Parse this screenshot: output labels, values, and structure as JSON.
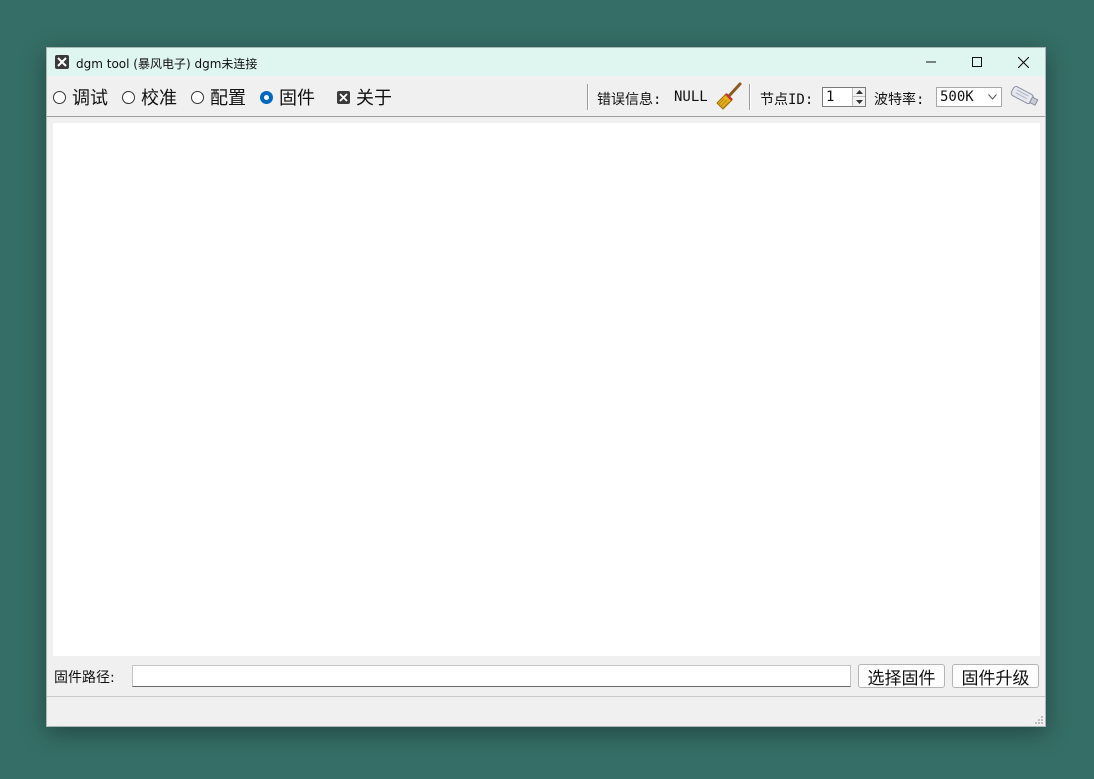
{
  "window": {
    "title": "dgm tool (暴风电子)  dgm未连接",
    "icon": "wrench-icon"
  },
  "toolbar": {
    "tabs": [
      {
        "label": "调试",
        "checked": false
      },
      {
        "label": "校准",
        "checked": false
      },
      {
        "label": "配置",
        "checked": false
      },
      {
        "label": "固件",
        "checked": true
      },
      {
        "label": "关于",
        "checked": false
      }
    ],
    "error_label": "错误信息:",
    "error_value": "NULL",
    "clear_icon": "broom-icon",
    "node_id_label": "节点ID:",
    "node_id_value": "1",
    "baud_label": "波特率:",
    "baud_value": "500K",
    "connect_icon": "usb-adapter-icon"
  },
  "firmware": {
    "path_label": "固件路径:",
    "path_value": "",
    "select_button": "选择固件",
    "upgrade_button": "固件升级"
  },
  "colors": {
    "background": "#356e66",
    "titlebar": "#dff5ef",
    "radio_checked": "#0067c0"
  }
}
